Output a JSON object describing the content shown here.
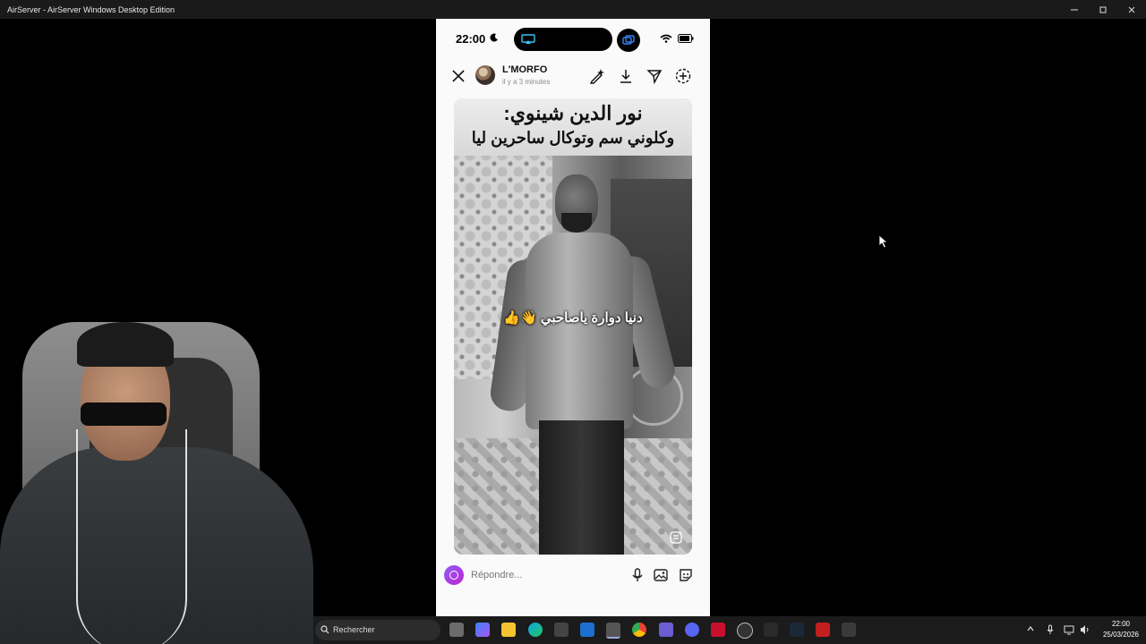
{
  "window": {
    "title": "AirServer - AirServer Windows Desktop Edition",
    "controls": [
      "minimize-icon",
      "maximize-icon",
      "close-icon"
    ]
  },
  "phone": {
    "status": {
      "time": "22:00"
    },
    "story": {
      "username": "L'MORFO",
      "timeago": "il y a 3 minutes",
      "caption_line1": "نور الدين شينوي:",
      "caption_line2": "وكلوني سم وتوكال ساحرين ليا",
      "overlay": "دنيا دوارة ياصاحبي 👋👍",
      "actions": [
        "draw-icon",
        "download-icon",
        "send-icon",
        "add-icon"
      ]
    },
    "reply": {
      "placeholder": "Répondre..."
    }
  },
  "taskbar": {
    "search_label": "Rechercher",
    "time": "22:00",
    "date": "25/03/2026"
  },
  "colors": {
    "accent": "#8b5cf6",
    "taskbar": "#1b1b1b"
  }
}
